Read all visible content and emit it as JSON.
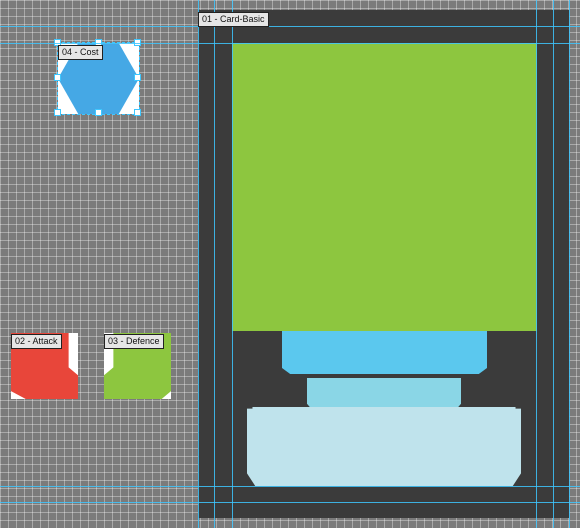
{
  "layers": {
    "card_basic": "01 - Card-Basic",
    "attack": "02 - Attack",
    "defence": "03 - Defence",
    "cost": "04 - Cost"
  },
  "colors": {
    "canvas": "#7b7b7b",
    "card_frame": "#3b3b3b",
    "card_art": "#8dc63f",
    "card_bar_primary": "#5bc8ee",
    "card_bar_secondary": "#8ad6e6",
    "card_text_box": "#bfe3ec",
    "cost_hex": "#45a8e5",
    "attack": "#e8463a",
    "defence": "#8dc63f",
    "guide": "#3ec7ff"
  }
}
